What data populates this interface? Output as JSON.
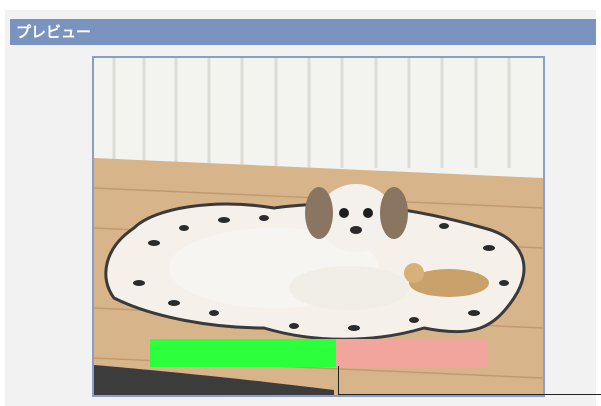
{
  "window": {
    "title": "プレビュー"
  },
  "preview": {
    "image_subject": "dog-on-mat-camera-preview",
    "overlay_left_color": "#2cff3b",
    "overlay_right_color": "#f2a59d"
  }
}
